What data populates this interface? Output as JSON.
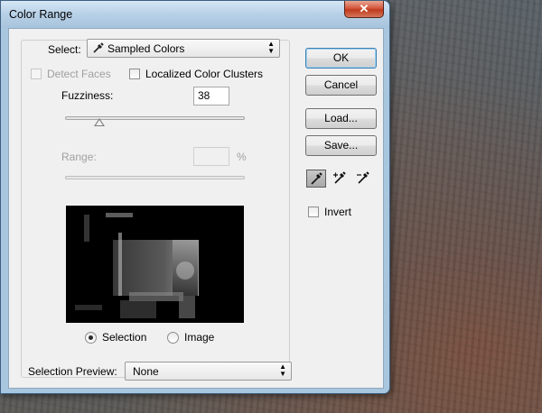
{
  "window": {
    "title": "Color Range",
    "close_glyph": "✕"
  },
  "select": {
    "label": "Select:",
    "value": "Sampled Colors",
    "icon": "eyedropper-icon"
  },
  "options": {
    "detect_faces": {
      "label": "Detect Faces",
      "checked": false,
      "enabled": false
    },
    "localized_clusters": {
      "label": "Localized Color Clusters",
      "checked": false
    }
  },
  "fuzziness": {
    "label": "Fuzziness:",
    "value": "38",
    "level": 0.19
  },
  "range": {
    "label": "Range:",
    "value": "",
    "unit": "%",
    "enabled": false
  },
  "preview_mode": {
    "selection_label": "Selection",
    "image_label": "Image",
    "selected": "Selection"
  },
  "selection_preview": {
    "label": "Selection Preview:",
    "value": "None"
  },
  "buttons": {
    "ok": "OK",
    "cancel": "Cancel",
    "load": "Load...",
    "save": "Save..."
  },
  "tools": [
    "eyedropper-icon",
    "eyedropper-plus-icon",
    "eyedropper-minus-icon"
  ],
  "invert": {
    "label": "Invert",
    "checked": false
  }
}
